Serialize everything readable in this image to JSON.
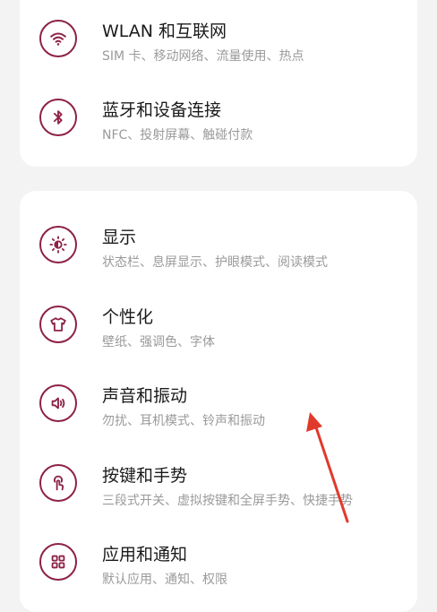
{
  "colors": {
    "accent": "#8d2246",
    "background": "#f3f3f4",
    "card": "#ffffff",
    "title_text": "#1a1a1a",
    "subtitle_text": "#9a9a9a",
    "annotation_arrow": "#e03a2c"
  },
  "network_group": {
    "items": [
      {
        "icon": "wifi-icon",
        "title": "WLAN 和互联网",
        "subtitle": "SIM 卡、移动网络、流量使用、热点"
      },
      {
        "icon": "bluetooth-icon",
        "title": "蓝牙和设备连接",
        "subtitle": "NFC、投射屏幕、触碰付款"
      }
    ]
  },
  "device_group": {
    "items": [
      {
        "icon": "brightness-icon",
        "title": "显示",
        "subtitle": "状态栏、息屏显示、护眼模式、阅读模式"
      },
      {
        "icon": "tshirt-icon",
        "title": "个性化",
        "subtitle": "壁纸、强调色、字体"
      },
      {
        "icon": "speaker-icon",
        "title": "声音和振动",
        "subtitle": "勿扰、耳机模式、铃声和振动"
      },
      {
        "icon": "touch-gesture-icon",
        "title": "按键和手势",
        "subtitle": "三段式开关、虚拟按键和全屏手势、快捷手势"
      },
      {
        "icon": "apps-grid-icon",
        "title": "应用和通知",
        "subtitle": "默认应用、通知、权限"
      }
    ]
  }
}
